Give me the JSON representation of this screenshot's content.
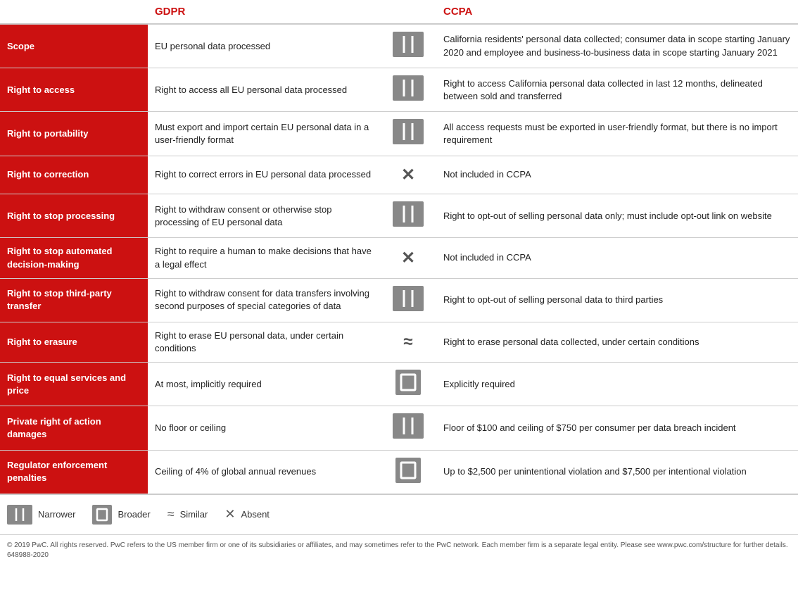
{
  "header": {
    "col1": "",
    "col2": "GDPR",
    "col3": "",
    "col4": "CCPA"
  },
  "rows": [
    {
      "label": "Scope",
      "gdpr": "EU personal data processed",
      "icon": "narrower",
      "ccpa": "California residents' personal data collected; consumer data in scope starting January 2020 and employee and business-to-business data in scope starting January 2021"
    },
    {
      "label": "Right to access",
      "gdpr": "Right to access all EU personal data processed",
      "icon": "narrower",
      "ccpa": "Right to access California personal data collected in last 12 months, delineated between sold and transferred"
    },
    {
      "label": "Right to portability",
      "gdpr": "Must export and import certain EU personal data in a user-friendly format",
      "icon": "narrower",
      "ccpa": "All access requests must be exported in user-friendly format, but there is no import requirement"
    },
    {
      "label": "Right to correction",
      "gdpr": "Right to correct errors in EU personal data processed",
      "icon": "absent",
      "ccpa": "Not included in CCPA"
    },
    {
      "label": "Right to stop processing",
      "gdpr": "Right to withdraw consent or otherwise stop processing of EU personal data",
      "icon": "narrower",
      "ccpa": "Right to opt-out of selling personal data only; must include opt-out link on website"
    },
    {
      "label": "Right to stop automated decision-making",
      "gdpr": "Right to require a human to make decisions that have a legal effect",
      "icon": "absent",
      "ccpa": "Not included in CCPA"
    },
    {
      "label": "Right to stop third-party transfer",
      "gdpr": "Right to withdraw consent for data transfers involving second purposes of special categories of data",
      "icon": "narrower",
      "ccpa": "Right to opt-out of selling personal data to third parties"
    },
    {
      "label": "Right to erasure",
      "gdpr": "Right to erase EU personal data, under certain conditions",
      "icon": "similar",
      "ccpa": "Right to erase personal data collected, under certain conditions"
    },
    {
      "label": "Right to equal services and price",
      "gdpr": "At most, implicitly required",
      "icon": "broader",
      "ccpa": "Explicitly required"
    },
    {
      "label": "Private right of action damages",
      "gdpr": "No floor or ceiling",
      "icon": "narrower",
      "ccpa": "Floor of $100 and ceiling of $750 per consumer per data breach incident"
    },
    {
      "label": "Regulator enforcement penalties",
      "gdpr": "Ceiling of 4% of global annual revenues",
      "icon": "broader",
      "ccpa": "Up to $2,500 per unintentional violation and $7,500 per intentional violation"
    }
  ],
  "legend": {
    "narrower_label": "Narrower",
    "broader_label": "Broader",
    "similar_label": "Similar",
    "absent_label": "Absent",
    "similar_symbol": "≈",
    "absent_symbol": "✕"
  },
  "footer": {
    "text": "© 2019 PwC. All rights reserved. PwC refers to the US member firm or one of its subsidiaries or affiliates, and may sometimes refer to the PwC network. Each member firm is a separate legal entity. Please see www.pwc.com/structure for further details. 648988-2020"
  }
}
